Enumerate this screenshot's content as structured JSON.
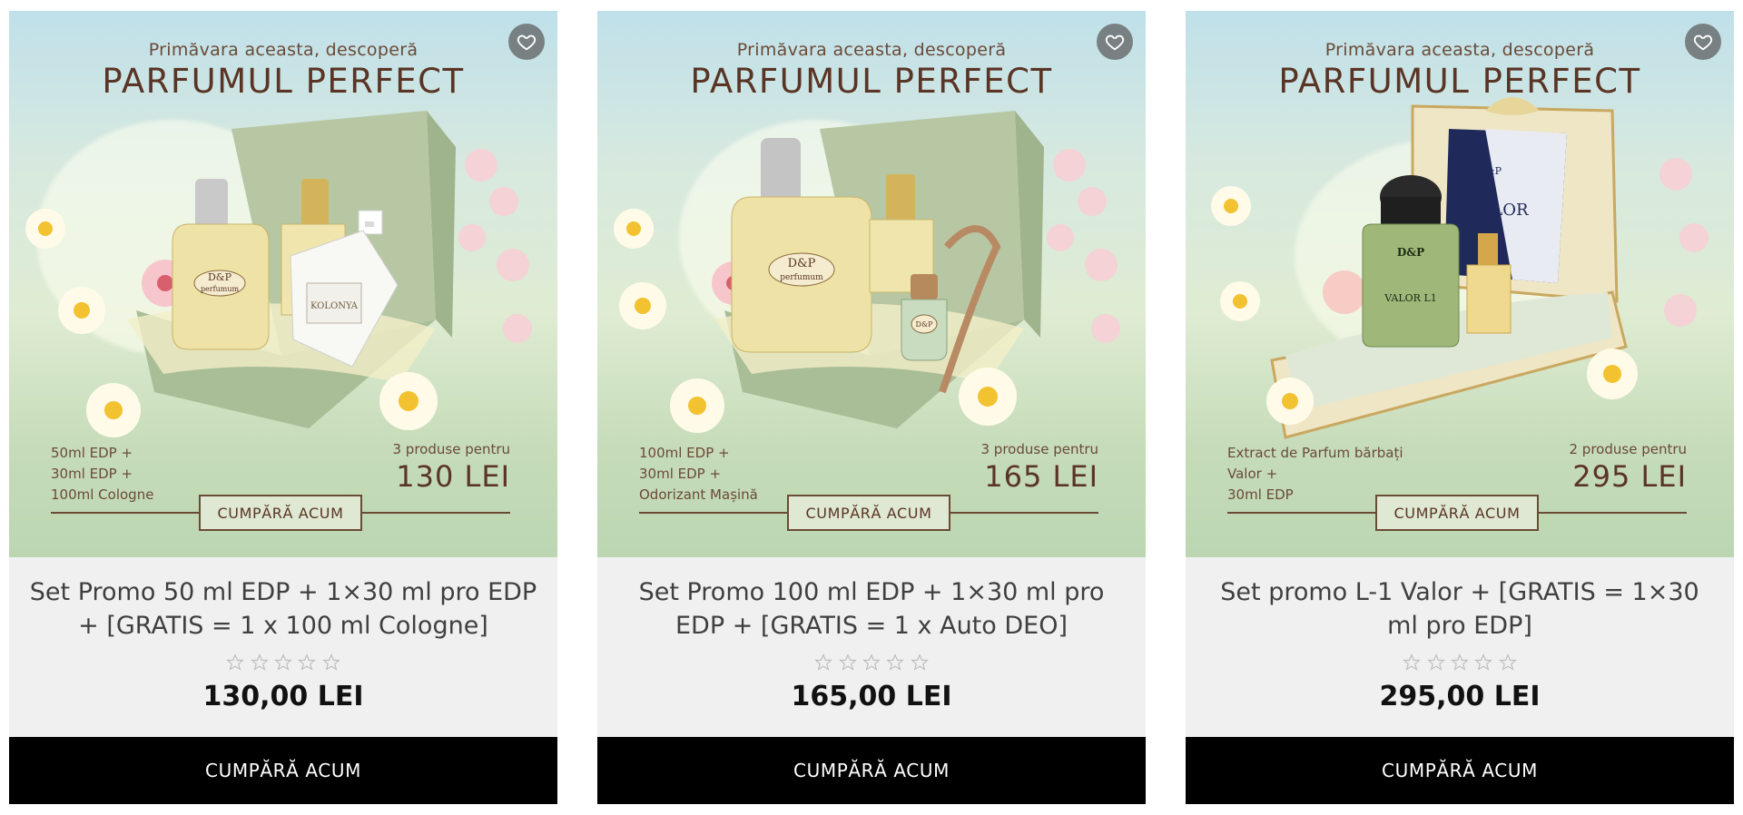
{
  "colors": {
    "accent_brown": "#5a3424",
    "buy_button_bg": "#000000",
    "card_bg": "#f0f0f0"
  },
  "products": [
    {
      "promo": {
        "headline_small": "Primăvara aceasta, descoperă",
        "headline_big": "PARFUMUL PERFECT",
        "lines": [
          "50ml EDP +",
          "30ml EDP +",
          "100ml Cologne"
        ],
        "deal_label": "3 produse pentru",
        "deal_price": "130 LEI",
        "cta": "CUMPĂRĂ ACUM",
        "bottle_labels": [
          "D&P perfumum",
          "KOLONYA"
        ]
      },
      "favorite_icon": "heart-icon",
      "title": "Set Promo 50 ml EDP + 1×30 ml pro EDP + [GRATIS = 1 x 100 ml Cologne]",
      "rating": 0,
      "price": "130,00 LEI",
      "buy_label": "CUMPĂRĂ ACUM"
    },
    {
      "promo": {
        "headline_small": "Primăvara aceasta, descoperă",
        "headline_big": "PARFUMUL PERFECT",
        "lines": [
          "100ml EDP +",
          "30ml EDP +",
          "Odorizant Mașină"
        ],
        "deal_label": "3 produse pentru",
        "deal_price": "165 LEI",
        "cta": "CUMPĂRĂ ACUM",
        "bottle_labels": [
          "D&P perfumum",
          "D&P"
        ]
      },
      "favorite_icon": "heart-icon",
      "title": "Set Promo 100 ml EDP + 1×30 ml pro EDP + [GRATIS = 1 x Auto DEO]",
      "rating": 0,
      "price": "165,00 LEI",
      "buy_label": "CUMPĂRĂ ACUM"
    },
    {
      "promo": {
        "headline_small": "Primăvara aceasta, descoperă",
        "headline_big": "PARFUMUL PERFECT",
        "lines": [
          "Extract de Parfum bărbați",
          "Valor +",
          "30ml EDP"
        ],
        "deal_label": "2 produse pentru",
        "deal_price": "295 LEI",
        "cta": "CUMPĂRĂ ACUM",
        "bottle_labels": [
          "D&P",
          "VALOR L1",
          "D&P",
          "VALOR"
        ]
      },
      "favorite_icon": "heart-icon",
      "title": "Set promo L-1 Valor + [GRATIS = 1×30 ml pro EDP]",
      "rating": 0,
      "price": "295,00 LEI",
      "buy_label": "CUMPĂRĂ ACUM"
    }
  ]
}
